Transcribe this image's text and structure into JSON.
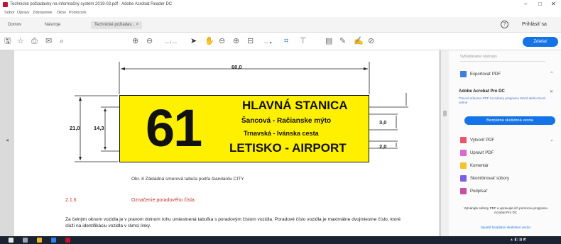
{
  "window": {
    "title": "Technické požiadavky na informačný systém 2019-03.pdf - Adobe Acrobat Reader DC",
    "minimize": "–",
    "maximize": "□",
    "close": "✕"
  },
  "menu": [
    "Súbor",
    "Úpravy",
    "Zobrazenie",
    "Okno",
    "Pomocník"
  ],
  "tabs": [
    "Domov",
    "Nástroje",
    "Technické požiadav... ×"
  ],
  "header": {
    "help": "?",
    "signin": "Prihlásiť sa"
  },
  "toolbar": {
    "icons": [
      "save-icon",
      "star-icon",
      "print-icon",
      "mail-icon",
      "search-icon",
      "page-up-icon",
      "page-down-icon",
      "page-indicator",
      "select-cursor-icon",
      "hand-icon",
      "zoom-out-icon",
      "zoom-in-icon",
      "zoom-level",
      "fit-icon",
      "crop-icon",
      "comment-icon",
      "highlight-icon",
      "sign-icon",
      "stamp-icon",
      "link-icon"
    ],
    "share_label": "Zdieľať"
  },
  "document": {
    "sign": {
      "number": "61",
      "line1": "HLAVNÁ STANICA",
      "line2": "Šancová - Račianske mýto",
      "line3": "Trnavská - Ivánska cesta",
      "line4": "LETISKO - AIRPORT"
    },
    "dims": {
      "width": "60,0",
      "height_outer": "21,0",
      "height_inner": "14,3",
      "right1": "3,0",
      "right2": "2,0"
    },
    "caption": "Obr. 8 Základná smerová tabuľa podľa štandardu CITY",
    "section_number": "2.1.6",
    "section_title": "Označenie poradového čísla",
    "body": "Za čelným oknom vozidla je v pravom dolnom rohu umiestnená tabuľka s poradovým číslom vozidla. Poradové číslo vozidla je maximálne dvojmiestne číslo, ktoré slúži na identifikáciu vozidla v rámci linky."
  },
  "right_pane": {
    "search_placeholder": "Vyhľadávanie nástrojov",
    "export_pdf": "Exportovať PDF",
    "promo_title": "Adobe Acrobat Pro DC",
    "promo_text": "Prevod súborov PDF na súbory programu Word alebo Excel online",
    "trial_button": "Bezplatná skúšobná verzia",
    "tools": [
      "Vytvoriť PDF",
      "Upraviť PDF",
      "Komentár",
      "Skombinovať súbory",
      "Podpísať"
    ],
    "footer": "Vytvárajte súbory PDF a upravujte ich pomocou programu Acrobat Pro DC",
    "footer_link": "Spustiť bezplatnú skúšobnú verziu"
  },
  "colors": {
    "accent": "#1473e6",
    "sign_yellow": "#fff000",
    "heading_red": "#c0392b"
  }
}
